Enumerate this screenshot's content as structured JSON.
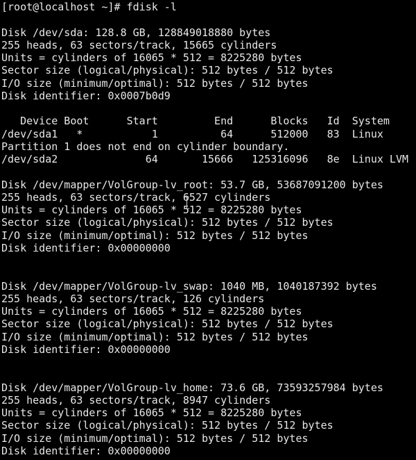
{
  "terminal": {
    "prompt": "[root@localhost ~]# fdisk -l",
    "lines": [
      "[root@localhost ~]# fdisk -l",
      "",
      "Disk /dev/sda: 128.8 GB, 128849018880 bytes",
      "255 heads, 63 sectors/track, 15665 cylinders",
      "Units = cylinders of 16065 * 512 = 8225280 bytes",
      "Sector size (logical/physical): 512 bytes / 512 bytes",
      "I/O size (minimum/optimal): 512 bytes / 512 bytes",
      "Disk identifier: 0x0007b0d9",
      "",
      "   Device Boot      Start         End      Blocks   Id  System",
      "/dev/sda1   *           1          64      512000   83  Linux",
      "Partition 1 does not end on cylinder boundary.",
      "/dev/sda2              64       15666   125316096   8e  Linux LVM",
      "",
      "Disk /dev/mapper/VolGroup-lv_root: 53.7 GB, 53687091200 bytes",
      "255 heads, 63 sectors/track, 6527 cylinders",
      "Units = cylinders of 16065 * 512 = 8225280 bytes",
      "Sector size (logical/physical): 512 bytes / 512 bytes",
      "I/O size (minimum/optimal): 512 bytes / 512 bytes",
      "Disk identifier: 0x00000000",
      "",
      "",
      "Disk /dev/mapper/VolGroup-lv_swap: 1040 MB, 1040187392 bytes",
      "255 heads, 63 sectors/track, 126 cylinders",
      "Units = cylinders of 16065 * 512 = 8225280 bytes",
      "Sector size (logical/physical): 512 bytes / 512 bytes",
      "I/O size (minimum/optimal): 512 bytes / 512 bytes",
      "Disk identifier: 0x00000000",
      "",
      "",
      "Disk /dev/mapper/VolGroup-lv_home: 73.6 GB, 73593257984 bytes",
      "255 heads, 63 sectors/track, 8947 cylinders",
      "Units = cylinders of 16065 * 512 = 8225280 bytes",
      "Sector size (logical/physical): 512 bytes / 512 bytes",
      "I/O size (minimum/optimal): 512 bytes / 512 bytes",
      "Disk identifier: 0x00000000"
    ]
  },
  "colors": {
    "background": "#000000",
    "foreground": "#e8e8e8"
  },
  "cursor": {
    "icon": "text-ibeam-cursor-icon"
  }
}
